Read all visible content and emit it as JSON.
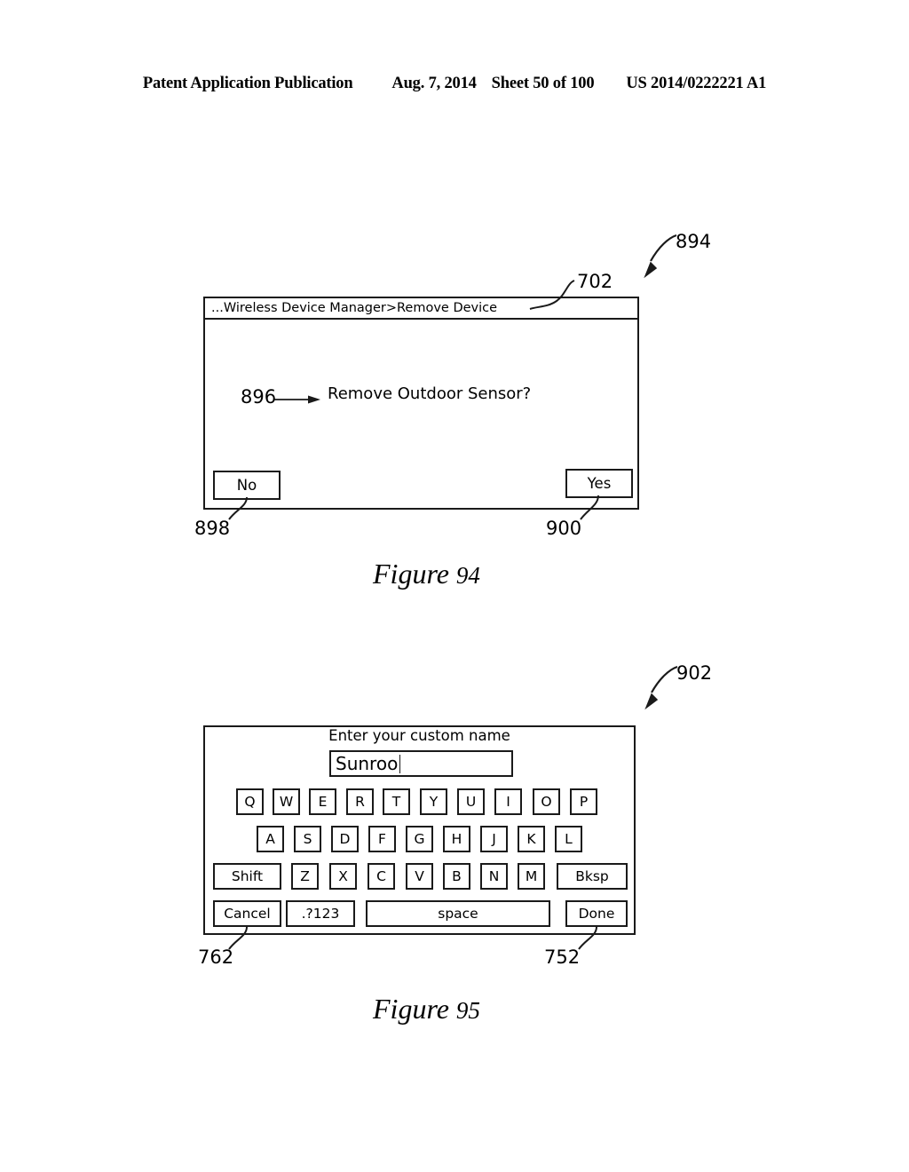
{
  "header": {
    "publication": "Patent Application Publication",
    "date": "Aug. 7, 2014",
    "sheet": "Sheet 50 of 100",
    "patent_number": "US 2014/0222221 A1"
  },
  "figure94": {
    "caption_word": "Figure",
    "caption_number": "94",
    "ref_figure": "894",
    "ref_titlebar": "702",
    "ref_prompt": "896",
    "ref_no_button": "898",
    "ref_yes_button": "900",
    "breadcrumb": "...Wireless Device Manager>Remove Device",
    "prompt": "Remove Outdoor Sensor?",
    "no_label": "No",
    "yes_label": "Yes"
  },
  "figure95": {
    "caption_word": "Figure",
    "caption_number": "95",
    "ref_figure": "902",
    "ref_cancel_button": "762",
    "ref_done_button": "752",
    "title": "Enter your custom name",
    "input_value": "Sunroo",
    "keyboard": {
      "row1": [
        "Q",
        "W",
        "E",
        "R",
        "T",
        "Y",
        "U",
        "I",
        "O",
        "P"
      ],
      "row2": [
        "A",
        "S",
        "D",
        "F",
        "G",
        "H",
        "J",
        "K",
        "L"
      ],
      "row3": [
        "Shift",
        "Z",
        "X",
        "C",
        "V",
        "B",
        "N",
        "M",
        "Bksp"
      ],
      "row4": [
        "Cancel",
        ".?123",
        "space",
        "Done"
      ]
    }
  },
  "colors": {
    "ink": "#1a1a1a",
    "paper": "#ffffff"
  }
}
